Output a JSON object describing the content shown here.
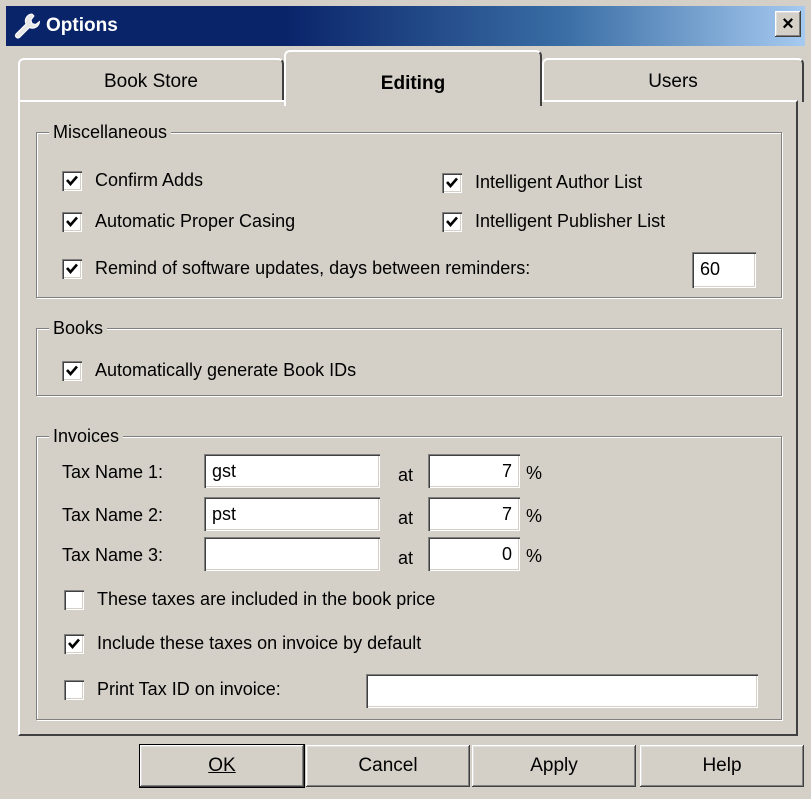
{
  "window": {
    "title": "Options",
    "close_label": "×"
  },
  "tabs": [
    {
      "label": "Book Store",
      "active": false
    },
    {
      "label": "Editing",
      "active": true
    },
    {
      "label": "Users",
      "active": false
    }
  ],
  "misc": {
    "label": "Miscellaneous",
    "confirm_adds": {
      "label": "Confirm Adds",
      "checked": true
    },
    "proper_casing": {
      "label": "Automatic Proper Casing",
      "checked": true
    },
    "intelligent_author": {
      "label": "Intelligent Author List",
      "checked": true
    },
    "intelligent_publisher": {
      "label": "Intelligent Publisher List",
      "checked": true
    },
    "remind_updates": {
      "label": "Remind of software updates, days between reminders:",
      "checked": true,
      "days": "60"
    }
  },
  "books": {
    "label": "Books",
    "auto_ids": {
      "label": "Automatically generate Book IDs",
      "checked": true
    }
  },
  "invoices": {
    "label": "Invoices",
    "at_label": "at",
    "percent": "%",
    "taxes": [
      {
        "label": "Tax Name 1:",
        "name": "gst",
        "rate": "7"
      },
      {
        "label": "Tax Name 2:",
        "name": "pst",
        "rate": "7"
      },
      {
        "label": "Tax Name 3:",
        "name": "",
        "rate": "0"
      }
    ],
    "included_in_price": {
      "label": "These taxes are included in the book price",
      "checked": false
    },
    "include_by_default": {
      "label": "Include these taxes on invoice by default",
      "checked": true
    },
    "print_tax_id": {
      "label": "Print Tax ID on invoice:",
      "checked": false,
      "value": ""
    }
  },
  "buttons": {
    "ok": "OK",
    "cancel": "Cancel",
    "apply": "Apply",
    "help": "Help"
  }
}
